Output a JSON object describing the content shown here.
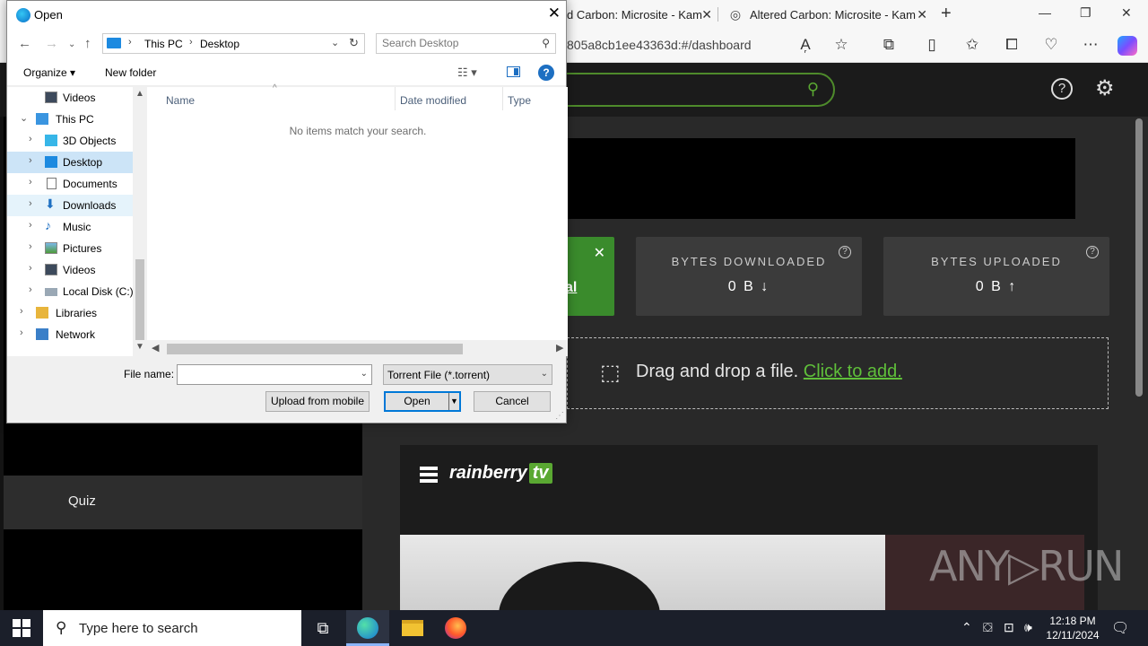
{
  "browser": {
    "tabs": [
      {
        "title": "d Carbon: Microsite - Kam"
      },
      {
        "title": "Altered Carbon: Microsite - Kam"
      }
    ],
    "address": "805a8cb1ee43363d:#/dashboard"
  },
  "site": {
    "sidebar": {
      "quiz": "Quiz"
    },
    "stats": [
      {
        "label": "BYTES DOWNLOADED",
        "value": "0 B ↓"
      },
      {
        "label": "BYTES UPLOADED",
        "value": "0 B ↑"
      }
    ],
    "green_card_link": "al",
    "dropzone": {
      "text": "Drag and drop a file.",
      "link": "Click to add."
    },
    "player": {
      "brand": "rainberry",
      "brand_tv": "tv"
    },
    "watermark": "ANY▷RUN"
  },
  "dialog": {
    "title": "Open",
    "path": [
      "This PC",
      "Desktop"
    ],
    "search_placeholder": "Search Desktop",
    "organize": "Organize ▾",
    "new_folder": "New folder",
    "tree": [
      {
        "label": "Videos"
      },
      {
        "label": "This PC"
      },
      {
        "label": "3D Objects"
      },
      {
        "label": "Desktop"
      },
      {
        "label": "Documents"
      },
      {
        "label": "Downloads"
      },
      {
        "label": "Music"
      },
      {
        "label": "Pictures"
      },
      {
        "label": "Videos"
      },
      {
        "label": "Local Disk (C:)"
      },
      {
        "label": "Libraries"
      },
      {
        "label": "Network"
      }
    ],
    "columns": {
      "name": "Name",
      "date": "Date modified",
      "type": "Type"
    },
    "empty_message": "No items match your search.",
    "file_name_label": "File name:",
    "file_name_value": "",
    "file_type": "Torrent File (*.torrent)",
    "buttons": {
      "upload": "Upload from mobile",
      "open": "Open",
      "cancel": "Cancel"
    }
  },
  "taskbar": {
    "search_placeholder": "Type here to search",
    "time": "12:18 PM",
    "date": "12/11/2024"
  }
}
